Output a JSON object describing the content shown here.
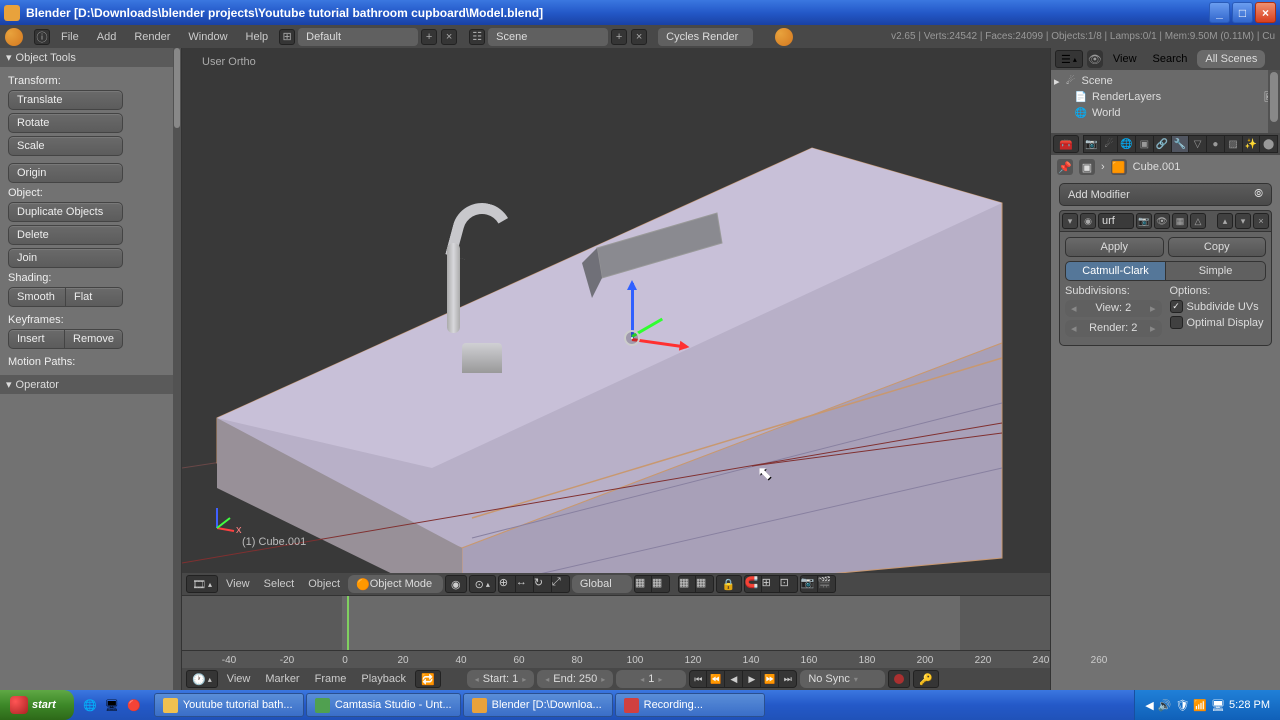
{
  "title": "Blender [D:\\Downloads\\blender projects\\Youtube tutorial bathroom cupboard\\Model.blend]",
  "menu": {
    "items": [
      "File",
      "Add",
      "Render",
      "Window",
      "Help"
    ],
    "layout": "Default",
    "scene": "Scene",
    "engine": "Cycles Render"
  },
  "stats": "v2.65 | Verts:24542 | Faces:24099 | Objects:1/8 | Lamps:0/1 | Mem:9.50M (0.11M) | Cu",
  "tools": {
    "header": "Object Tools",
    "transform_label": "Transform:",
    "translate": "Translate",
    "rotate": "Rotate",
    "scale": "Scale",
    "origin": "Origin",
    "object_label": "Object:",
    "duplicate": "Duplicate Objects",
    "delete": "Delete",
    "join": "Join",
    "shading_label": "Shading:",
    "smooth": "Smooth",
    "flat": "Flat",
    "keyframes_label": "Keyframes:",
    "insert": "Insert",
    "remove": "Remove",
    "motion_label": "Motion Paths:",
    "operator": "Operator"
  },
  "view3d": {
    "label": "User Ortho",
    "object": "(1) Cube.001"
  },
  "viewheader": {
    "view": "View",
    "select": "Select",
    "object": "Object",
    "mode": "Object Mode",
    "orient": "Global"
  },
  "timeline": {
    "view": "View",
    "marker": "Marker",
    "frame": "Frame",
    "playback": "Playback",
    "start": "Start: 1",
    "end": "End: 250",
    "current": "1",
    "sync": "No Sync",
    "ticks": [
      -40,
      -20,
      0,
      20,
      40,
      60,
      80,
      100,
      120,
      140,
      160,
      180,
      200,
      220,
      240,
      260
    ]
  },
  "outliner": {
    "view": "View",
    "search": "Search",
    "filter": "All Scenes",
    "scene": "Scene",
    "renderlayers": "RenderLayers",
    "world": "World"
  },
  "props": {
    "object": "Cube.001",
    "add_modifier": "Add Modifier",
    "mod_name": "urf",
    "apply": "Apply",
    "copy": "Copy",
    "catmull": "Catmull-Clark",
    "simple": "Simple",
    "subdiv_label": "Subdivisions:",
    "options_label": "Options:",
    "view_subdiv": "View: 2",
    "render_subdiv": "Render: 2",
    "subdivide_uvs": "Subdivide UVs",
    "optimal": "Optimal Display"
  },
  "taskbar": {
    "start": "start",
    "tasks": [
      "Youtube tutorial bath...",
      "Camtasia Studio - Unt...",
      "Blender [D:\\Downloa...",
      "Recording..."
    ],
    "time": "5:28 PM"
  }
}
